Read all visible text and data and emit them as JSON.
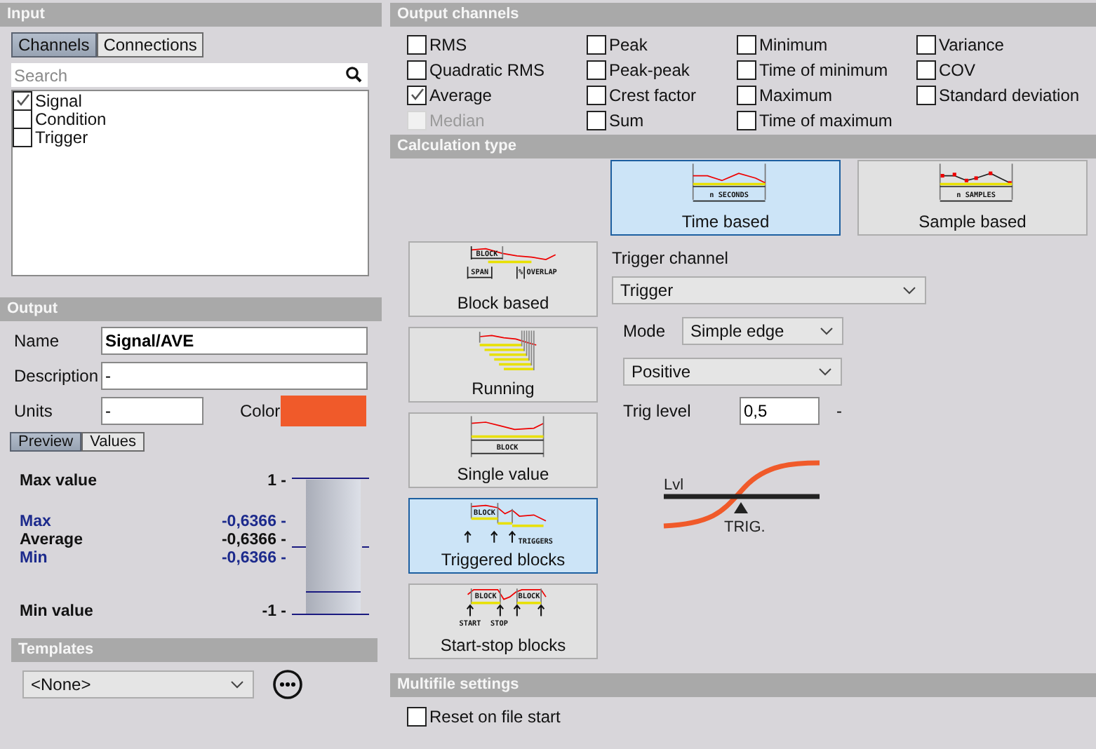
{
  "input": {
    "title": "Input",
    "tabs": [
      {
        "label": "Channels",
        "selected": true
      },
      {
        "label": "Connections",
        "selected": false
      }
    ],
    "search": {
      "placeholder": "Search"
    },
    "channels": [
      {
        "label": "Signal",
        "checked": true
      },
      {
        "label": "Condition",
        "checked": false
      },
      {
        "label": "Trigger",
        "checked": false
      }
    ]
  },
  "output": {
    "title": "Output",
    "fields": [
      {
        "label": "Name",
        "value": "Signal/AVE"
      },
      {
        "label": "Description",
        "value": "-"
      }
    ],
    "units": {
      "label": "Units",
      "value": "-"
    },
    "color": {
      "label": "Color",
      "color": "#f05a2a"
    },
    "tabs": [
      {
        "label": "Preview",
        "selected": true
      },
      {
        "label": "Values",
        "selected": false
      }
    ],
    "preview": {
      "max_value": {
        "label": "Max value",
        "reading": "1 -"
      },
      "stats": [
        {
          "kind": "max",
          "label": "Max",
          "reading": "-0,6366 -"
        },
        {
          "kind": "average",
          "label": "Average",
          "reading": "-0,6366 -"
        },
        {
          "kind": "min",
          "label": "Min",
          "reading": "-0,6366 -"
        }
      ],
      "min_value": {
        "label": "Min value",
        "reading": "-1 -"
      }
    }
  },
  "templates": {
    "title": "Templates",
    "select": "<None>"
  },
  "output_channels": {
    "title": "Output channels",
    "items": [
      {
        "label": "RMS",
        "checked": false,
        "disabled": false
      },
      {
        "label": "Peak",
        "checked": false,
        "disabled": false
      },
      {
        "label": "Minimum",
        "checked": false,
        "disabled": false
      },
      {
        "label": "Variance",
        "checked": false,
        "disabled": false
      },
      {
        "label": "Quadratic RMS",
        "checked": false,
        "disabled": false
      },
      {
        "label": "Peak-peak",
        "checked": false,
        "disabled": false
      },
      {
        "label": "Time of minimum",
        "checked": false,
        "disabled": false
      },
      {
        "label": "COV",
        "checked": false,
        "disabled": false
      },
      {
        "label": "Average",
        "checked": true,
        "disabled": false
      },
      {
        "label": "Crest factor",
        "checked": false,
        "disabled": false
      },
      {
        "label": "Maximum",
        "checked": false,
        "disabled": false
      },
      {
        "label": "Standard deviation",
        "checked": false,
        "disabled": false
      },
      {
        "label": "Median",
        "checked": false,
        "disabled": true
      },
      {
        "label": "Sum",
        "checked": false,
        "disabled": false
      },
      {
        "label": "Time of maximum",
        "checked": false,
        "disabled": false
      }
    ]
  },
  "calculation_type": {
    "title": "Calculation type",
    "top_options": [
      {
        "kind": "time",
        "label": "Time based",
        "selected": true,
        "diagram_labels": [
          "n SECONDS"
        ]
      },
      {
        "kind": "sample",
        "label": "Sample based",
        "selected": false,
        "diagram_labels": [
          "n SAMPLES"
        ]
      }
    ],
    "side_options": [
      {
        "kind": "block",
        "label": "Block based",
        "selected": false,
        "diagram_labels": [
          "BLOCK",
          "SPAN",
          "%",
          "OVERLAP"
        ]
      },
      {
        "kind": "running",
        "label": "Running",
        "selected": false
      },
      {
        "kind": "single",
        "label": "Single value",
        "selected": false,
        "diagram_labels": [
          "BLOCK"
        ]
      },
      {
        "kind": "triggered",
        "label": "Triggered blocks",
        "selected": true,
        "diagram_labels": [
          "BLOCK",
          "TRIGGERS"
        ]
      },
      {
        "kind": "startstop",
        "label": "Start-stop blocks",
        "selected": false,
        "diagram_labels": [
          "BLOCK",
          "BLOCK",
          "START",
          "STOP"
        ]
      }
    ]
  },
  "trigger": {
    "channel_label": "Trigger channel",
    "channel": "Trigger",
    "mode_label": "Mode",
    "mode": "Simple edge",
    "edge": "Positive",
    "level_label": "Trig level",
    "level_value": "0,5",
    "level_units": "-",
    "diagram": {
      "level_label": "Lvl",
      "trig_label": "TRIG."
    }
  },
  "multifile": {
    "title": "Multifile settings",
    "options": [
      {
        "label": "Reset on file start",
        "checked": false
      }
    ]
  }
}
